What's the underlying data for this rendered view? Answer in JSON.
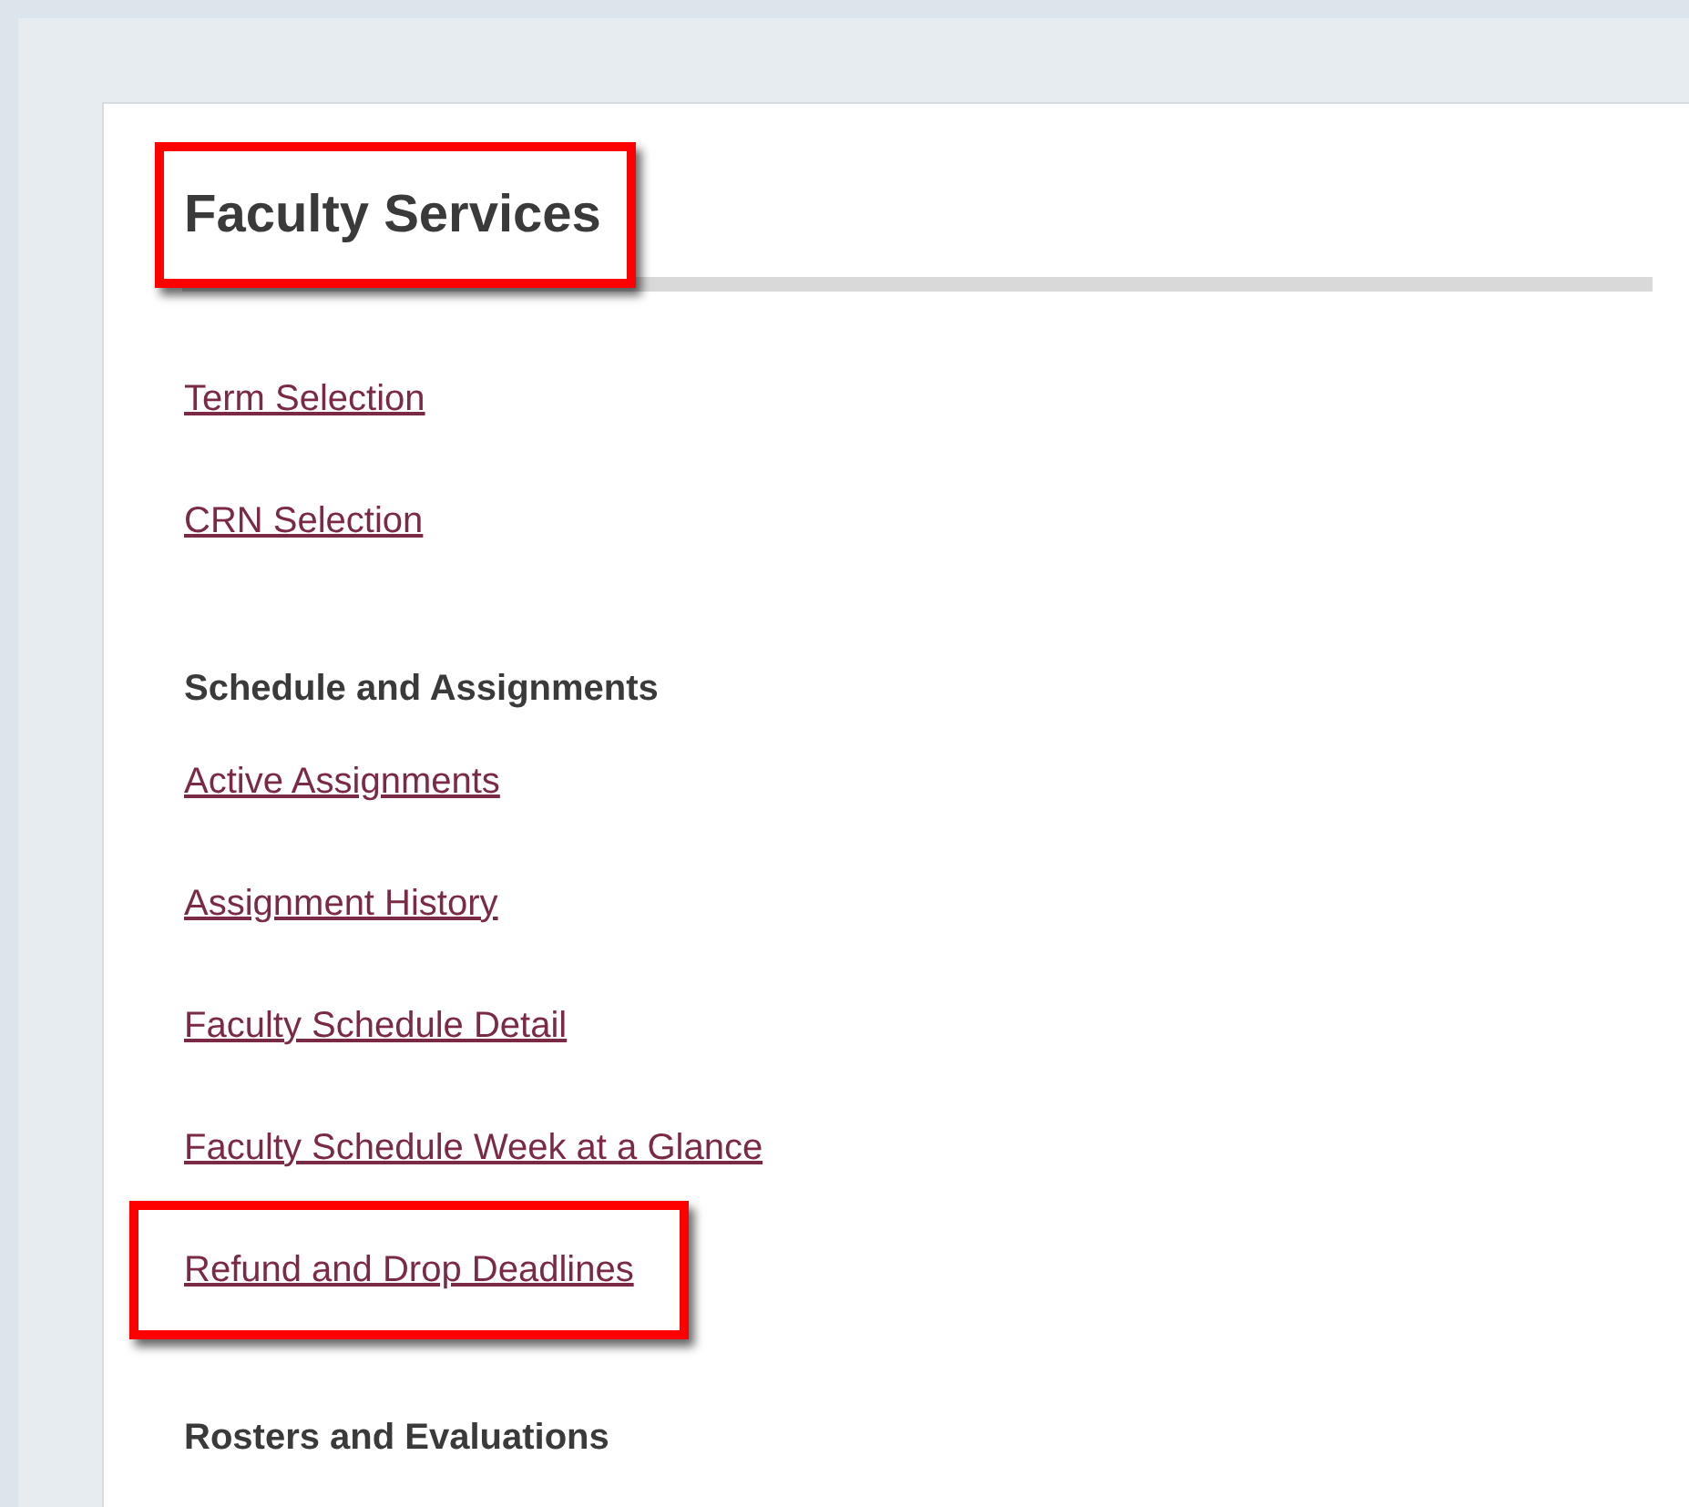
{
  "title": {
    "text": "Faculty Services",
    "highlighted": true
  },
  "items": [
    {
      "kind": "link",
      "text": "Term Selection",
      "highlighted": false
    },
    {
      "kind": "link",
      "text": "CRN Selection",
      "highlighted": false
    },
    {
      "kind": "heading",
      "text": "Schedule and Assignments",
      "highlighted": false
    },
    {
      "kind": "link",
      "text": "Active Assignments",
      "highlighted": false
    },
    {
      "kind": "link",
      "text": "Assignment History",
      "highlighted": false
    },
    {
      "kind": "link",
      "text": "Faculty Schedule Detail",
      "highlighted": false
    },
    {
      "kind": "link",
      "text": "Faculty Schedule Week at a Glance",
      "highlighted": false
    },
    {
      "kind": "link",
      "text": "Refund and Drop Deadlines",
      "highlighted": true
    },
    {
      "kind": "heading",
      "text": "Rosters and Evaluations",
      "highlighted": false
    }
  ]
}
